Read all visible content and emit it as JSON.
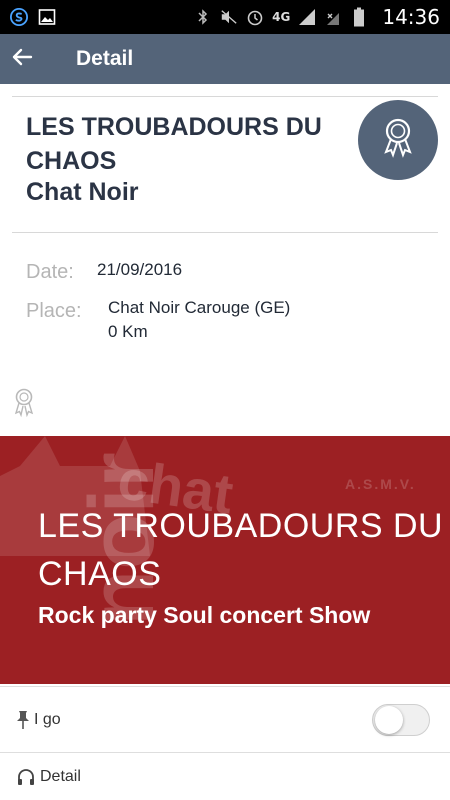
{
  "statusbar": {
    "time": "14:36",
    "network": "4G",
    "icons": [
      "app-s-icon",
      "image-icon",
      "bluetooth-icon",
      "mute-icon",
      "alarm-icon",
      "signal-icon",
      "no-sim-icon",
      "battery-icon"
    ]
  },
  "appbar": {
    "title": "Detail",
    "back_icon": "arrow-left-icon"
  },
  "event": {
    "title": "LES TROUBADOURS DU CHAOS",
    "venue_name": "Chat Noir",
    "badge_icon": "award-ribbon-icon"
  },
  "info": {
    "date_label": "Date:",
    "date_value": "21/09/2016",
    "place_label": "Place:",
    "place_value": "Chat Noir Carouge (GE)",
    "distance": "0 Km"
  },
  "banner": {
    "headline": "LES TROUBADOURS DU CHAOS",
    "tagline": "Rock party Soul concert Show",
    "watermark_logo": "chat",
    "watermark_asmv": "A.S.M.V.",
    "watermark_noir": "noir",
    "background_color": "#9c2023"
  },
  "actions": {
    "go_label": "I go",
    "go_icon": "pin-icon",
    "go_toggled": false,
    "detail_label": "Detail",
    "detail_icon": "headphones-icon"
  },
  "colors": {
    "appbar": "#546479",
    "title_text": "#2b3445",
    "label_text": "#b5b5b5"
  }
}
